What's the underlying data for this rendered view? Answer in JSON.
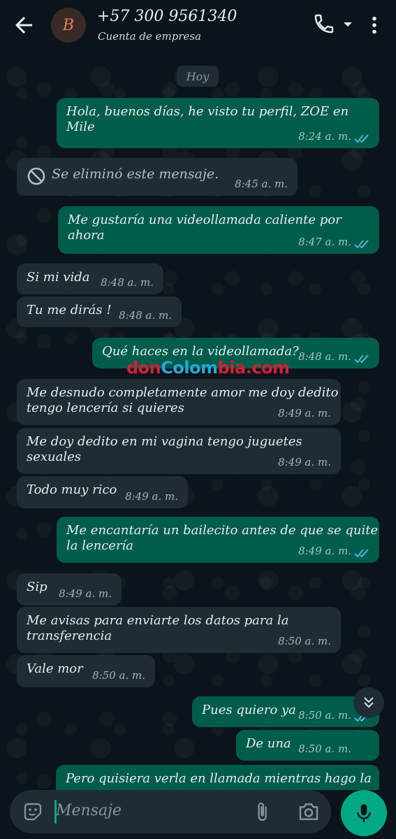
{
  "header": {
    "avatar_letter": "B",
    "contact_name": "+57 300 9561340",
    "subtitle": "Cuenta de empresa",
    "icons": [
      "back-arrow-icon",
      "phone-icon",
      "dropdown-icon",
      "more-vert-icon"
    ]
  },
  "date_chip": "Hoy",
  "messages": [
    {
      "dir": "out",
      "text": "Hola, buenos días, he visto tu perfil, ZOE en Mile",
      "time": "8:24 a. m.",
      "status": "read"
    },
    {
      "dir": "in",
      "text": "Se eliminó este mensaje.",
      "time": "8:45 a. m.",
      "deleted": true
    },
    {
      "dir": "out",
      "text": "Me gustaría una videollamada caliente por ahora",
      "time": "8:47 a. m.",
      "status": "read"
    },
    {
      "dir": "in",
      "text": "Si mi vida",
      "time": "8:48 a. m."
    },
    {
      "dir": "in",
      "text": "Tu me dirás !",
      "time": "8:48 a. m."
    },
    {
      "dir": "out",
      "text": "Qué haces en la videollamada?",
      "time": "8:48 a. m.",
      "status": "read"
    },
    {
      "dir": "in",
      "text": "Me desnudo completamente amor me doy dedito\ntengo lencería si quieres",
      "time": "8:49 a. m."
    },
    {
      "dir": "in",
      "text": "Me doy dedito en mi vagina tengo juguetes\nsexuales",
      "time": "8:49 a. m."
    },
    {
      "dir": "in",
      "text": "Todo muy rico",
      "time": "8:49 a. m."
    },
    {
      "dir": "out",
      "text": "Me encantaría un bailecito antes de que se quite\nla lencería",
      "time": "8:49 a. m.",
      "status": "read"
    },
    {
      "dir": "in",
      "text": "Sip",
      "time": "8:49 a. m."
    },
    {
      "dir": "in",
      "text": "Me avisas para enviarte los datos para la\ntransferencia",
      "time": "8:50 a. m."
    },
    {
      "dir": "in",
      "text": "Vale mor",
      "time": "8:50 a. m."
    },
    {
      "dir": "out",
      "text": "Pues quiero ya",
      "time": "8:50 a. m.",
      "status": "read"
    },
    {
      "dir": "out",
      "text": "De una",
      "time": "8:50 a. m."
    },
    {
      "dir": "out",
      "text": "Pero quisiera verla en llamada mientras hago la",
      "time": ""
    }
  ],
  "watermark": {
    "part1": "don",
    "part2": "Colom",
    "part3": "bia.com"
  },
  "composer": {
    "placeholder": "Mensaje",
    "icons": [
      "sticker-icon",
      "attach-icon",
      "camera-icon",
      "mic-icon"
    ]
  },
  "colors": {
    "incoming": "#1f2c33",
    "outgoing": "#005c4b",
    "accent": "#00a884",
    "read_tick": "#53bdeb"
  }
}
